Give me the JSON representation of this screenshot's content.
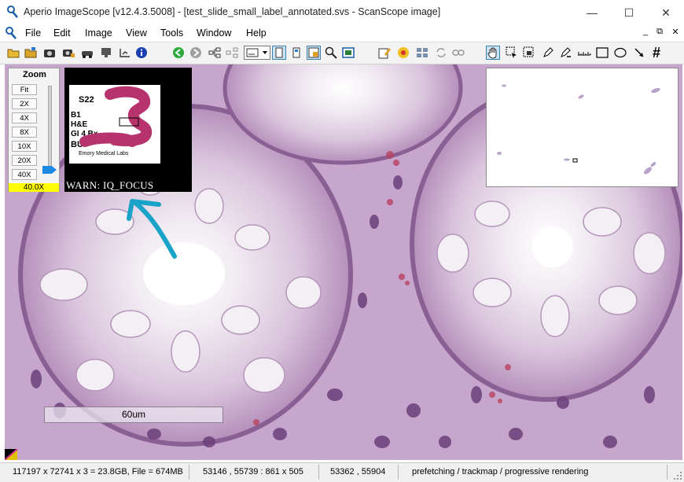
{
  "window": {
    "title": "Aperio ImageScope [v12.4.3.5008] - [test_slide_small_label_annotated.svs - ScanScope image]",
    "controls": {
      "minimize": "—",
      "maximize": "☐",
      "close": "✕"
    }
  },
  "menu": {
    "items": [
      "File",
      "Edit",
      "Image",
      "View",
      "Tools",
      "Window",
      "Help"
    ],
    "mdi": {
      "minimize": "_",
      "restore": "⧉",
      "close": "✕"
    }
  },
  "toolbar": {
    "icons": [
      "open-icon",
      "open-folder-icon",
      "camera-icon",
      "camera-settings-icon",
      "car-icon",
      "image-server-icon",
      "align-icon",
      "info-icon",
      "back-icon",
      "forward-icon",
      "tree-icon",
      "tree-alt-icon",
      "display-dropdown",
      "single-view-icon",
      "thumbnail-view-icon",
      "label-view-icon",
      "magnifier-icon",
      "overview-icon",
      "annotate-icon",
      "pen-settings-icon",
      "compare-icon",
      "sync-icon",
      "link-icon",
      "pan-tool-icon",
      "select-tool-icon",
      "snapshot-tool-icon",
      "pen-tool-icon",
      "ruler-tool-icon",
      "rectangle-tool-icon",
      "ellipse-tool-icon",
      "arrow-tool-icon",
      "grid-tool-icon"
    ]
  },
  "zoom": {
    "title": "Zoom",
    "buttons": [
      "Fit",
      "2X",
      "4X",
      "8X",
      "10X",
      "20X",
      "40X"
    ],
    "current": "40.0X",
    "accent": "#1e88e5"
  },
  "label": {
    "lines": [
      "S22",
      "B1",
      "H&E",
      "GI 4 Bx",
      "BU"
    ],
    "lab": "Emory Medical Labs",
    "warning": "WARN: IQ_FOCUS",
    "redaction_color": "#b7336d",
    "arrow_color": "#1aa3c8"
  },
  "scalebar": {
    "text": "60um"
  },
  "status": {
    "dimensions": "117197 x 72741 x 3 = 23.8GB, File = 674MB",
    "view": "53146 , 55739 : 861 x 505",
    "cursor": "53362 , 55904",
    "state": "prefetching / trackmap / progressive rendering"
  }
}
